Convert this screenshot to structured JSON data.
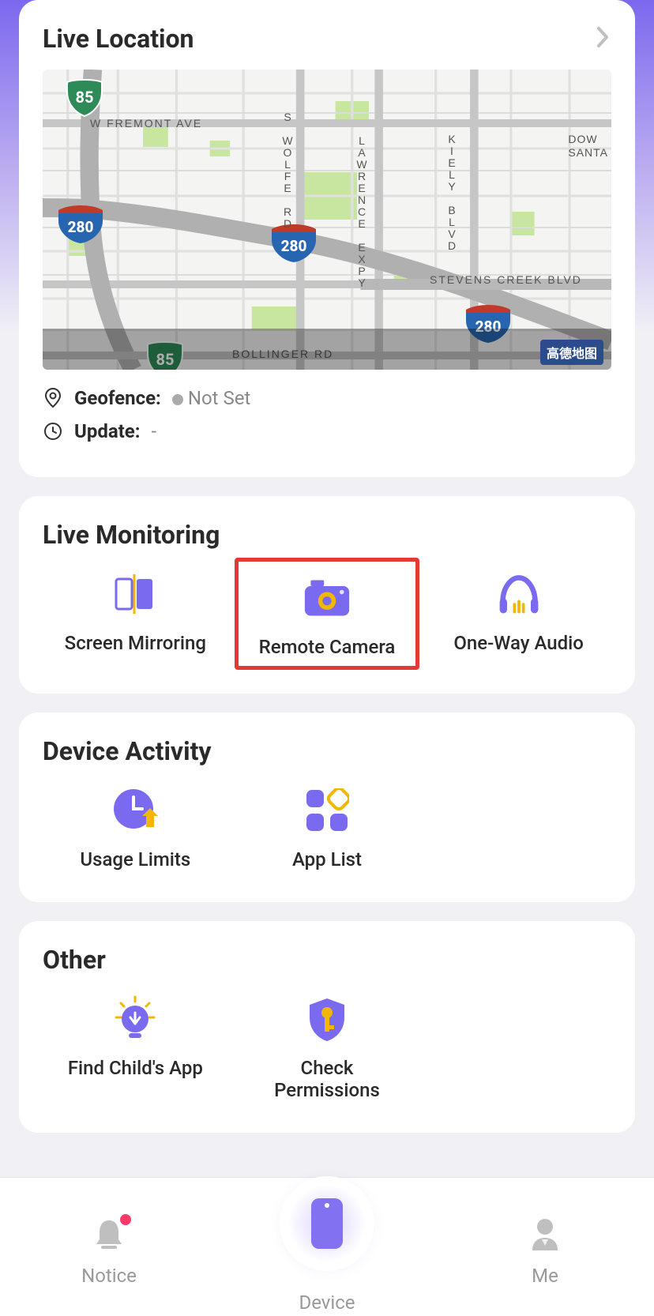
{
  "location": {
    "title": "Live Location",
    "geofence_label": "Geofence:",
    "geofence_value": "Not Set",
    "update_label": "Update:",
    "update_value": "-",
    "map": {
      "roads": {
        "fremont": "W FREMONT AVE",
        "wolfe": "S WOLFE RD",
        "lawrence": "LAWRENCE EXPY",
        "kiely": "KIELY BLVD",
        "stevens": "STEVENS CREEK BLVD",
        "bollinger": "BOLLINGER RD",
        "santa": "DOW\nSANTA"
      },
      "shields": {
        "s85": "85",
        "s280": "280"
      },
      "attribution": "高德地图"
    }
  },
  "monitoring": {
    "title": "Live Monitoring",
    "items": [
      {
        "label": "Screen Mirroring",
        "name": "screen-mirroring"
      },
      {
        "label": "Remote Camera",
        "name": "remote-camera",
        "highlight": true
      },
      {
        "label": "One-Way Audio",
        "name": "one-way-audio"
      }
    ]
  },
  "activity": {
    "title": "Device Activity",
    "items": [
      {
        "label": "Usage Limits",
        "name": "usage-limits"
      },
      {
        "label": "App List",
        "name": "app-list"
      }
    ]
  },
  "other": {
    "title": "Other",
    "items": [
      {
        "label": "Find Child's App",
        "name": "find-childs-app"
      },
      {
        "label": "Check\nPermissions",
        "name": "check-permissions"
      }
    ]
  },
  "tabs": {
    "notice": "Notice",
    "device": "Device",
    "me": "Me"
  }
}
